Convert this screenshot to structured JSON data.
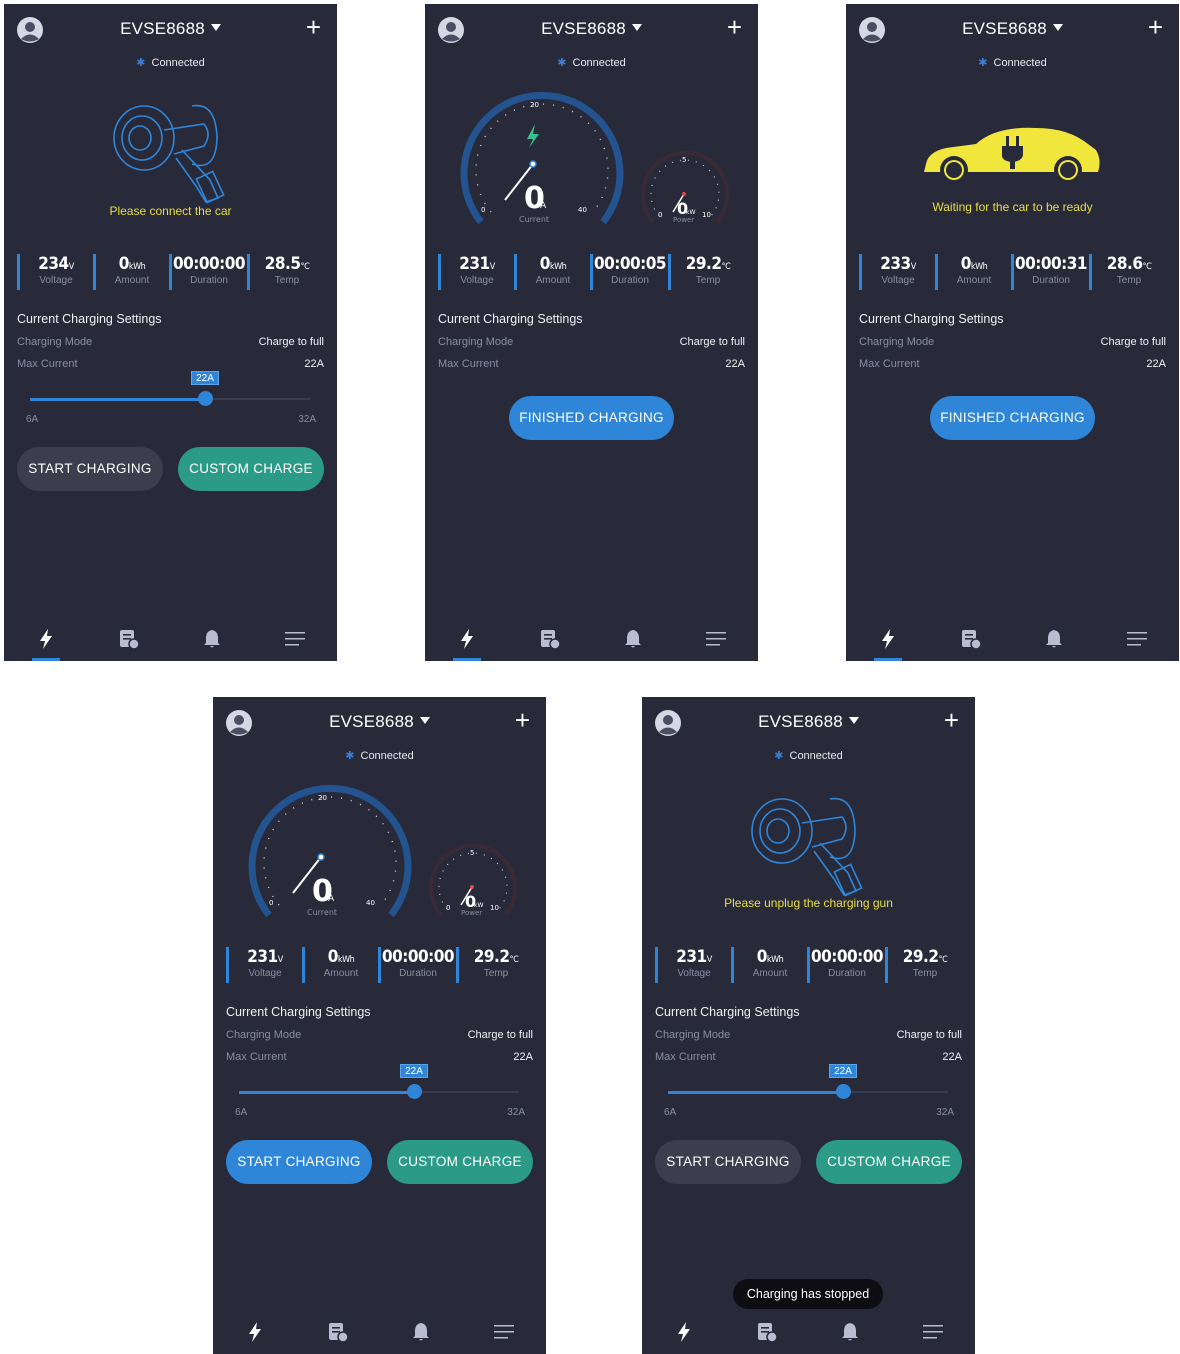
{
  "device_name": "EVSE8688",
  "status": "Connected",
  "settings_title": "Current Charging Settings",
  "charging_mode_label": "Charging Mode",
  "max_current_label": "Max Current",
  "charging_mode_value": "Charge to full",
  "max_current_value": "22A",
  "slider": {
    "bubble": "22A",
    "min": "6A",
    "max": "32A",
    "level": 0.625
  },
  "stat_labels": [
    "Voltage",
    "Amount",
    "Duration",
    "Temp"
  ],
  "units": {
    "voltage": "V",
    "amount": "kWh",
    "temp": "°C"
  },
  "buttons": {
    "start": "START CHARGING",
    "custom": "CUSTOM CHARGE",
    "finished": "FINISHED CHARGING"
  },
  "gauges": {
    "current": {
      "value": "0",
      "unit": "A",
      "label": "Current",
      "min": "0",
      "mid": "20",
      "max": "40"
    },
    "power": {
      "value": "0",
      "unit": "kW",
      "label": "Power",
      "min": "0",
      "mid": "5",
      "max": "10"
    }
  },
  "screens": [
    {
      "message": "Please connect the car",
      "voltage": "234",
      "amount": "0",
      "duration": "00:00:00",
      "temp": "28.5"
    },
    {
      "voltage": "231",
      "amount": "0",
      "duration": "00:00:05",
      "temp": "29.2"
    },
    {
      "message": "Waiting for the car to be ready",
      "voltage": "233",
      "amount": "0",
      "duration": "00:00:31",
      "temp": "28.6"
    },
    {
      "voltage": "231",
      "amount": "0",
      "duration": "00:00:00",
      "temp": "29.2"
    },
    {
      "message": "Please unplug the charging gun",
      "voltage": "231",
      "amount": "0",
      "duration": "00:00:00",
      "temp": "29.2",
      "toast": "Charging has stopped"
    }
  ],
  "icons": [
    "avatar-icon",
    "caret-down-icon",
    "plus-icon",
    "bluetooth-icon",
    "bolt-icon",
    "records-icon",
    "bell-icon",
    "menu-icon",
    "charger-plug-icon",
    "car-plug-icon"
  ],
  "colors": {
    "background": "#282a3a",
    "accent": "#2f86d9",
    "green": "#2b9b87",
    "warning_text": "#e7dd45",
    "car": "#f0e63c"
  }
}
